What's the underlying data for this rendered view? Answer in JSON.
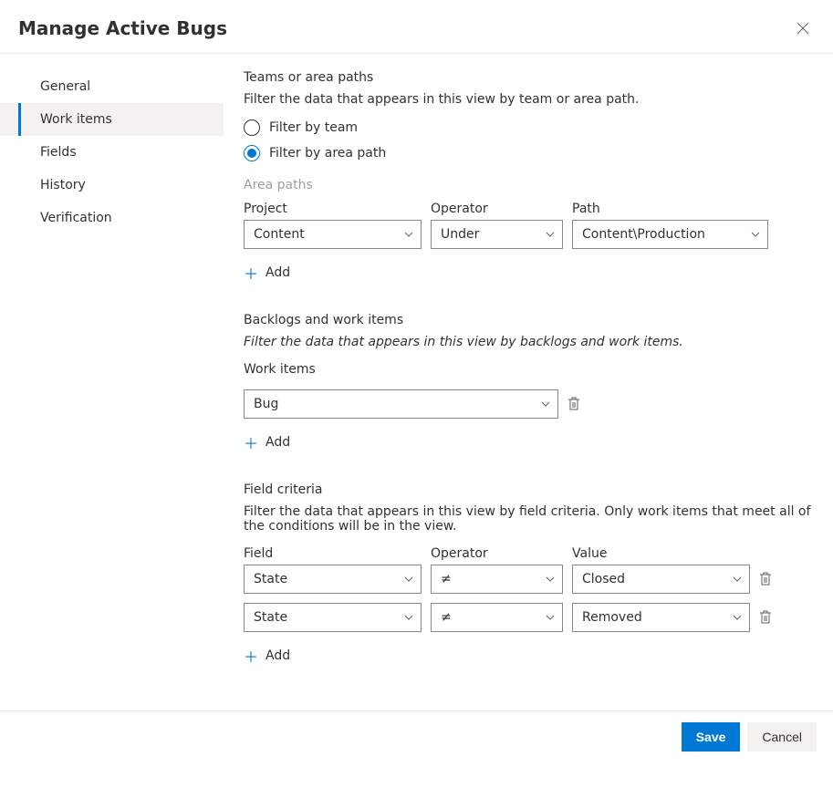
{
  "dialog": {
    "title": "Manage Active Bugs"
  },
  "sidebar": {
    "items": [
      {
        "label": "General",
        "active": false
      },
      {
        "label": "Work items",
        "active": true
      },
      {
        "label": "Fields",
        "active": false
      },
      {
        "label": "History",
        "active": false
      },
      {
        "label": "Verification",
        "active": false
      }
    ]
  },
  "teams_section": {
    "heading": "Teams or area paths",
    "description": "Filter the data that appears in this view by team or area path.",
    "options": {
      "filter_by_team": "Filter by team",
      "filter_by_area": "Filter by area path",
      "selected": "area"
    },
    "area_paths_label": "Area paths",
    "headers": {
      "project": "Project",
      "operator": "Operator",
      "path": "Path"
    },
    "rows": [
      {
        "project": "Content",
        "operator": "Under",
        "path": "Content\\Production"
      }
    ],
    "add_label": "Add"
  },
  "backlogs_section": {
    "heading": "Backlogs and work items",
    "description": "Filter the data that appears in this view by backlogs and work items.",
    "work_items_label": "Work items",
    "rows": [
      {
        "value": "Bug"
      }
    ],
    "add_label": "Add"
  },
  "criteria_section": {
    "heading": "Field criteria",
    "description": "Filter the data that appears in this view by field criteria. Only work items that meet all of the conditions will be in the view.",
    "headers": {
      "field": "Field",
      "operator": "Operator",
      "value": "Value"
    },
    "rows": [
      {
        "field": "State",
        "operator": "≠",
        "value": "Closed"
      },
      {
        "field": "State",
        "operator": "≠",
        "value": "Removed"
      }
    ],
    "add_label": "Add"
  },
  "footer": {
    "save": "Save",
    "cancel": "Cancel"
  }
}
